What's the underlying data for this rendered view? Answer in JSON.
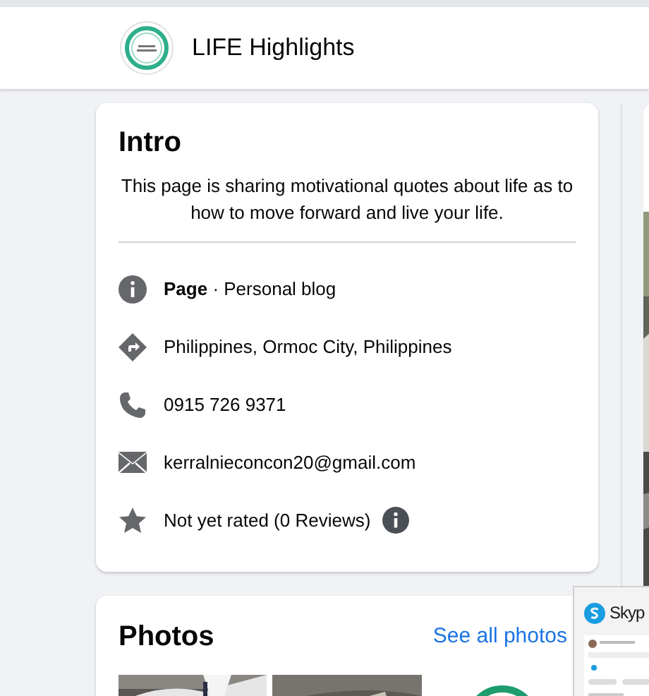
{
  "header": {
    "title": "LIFE Highlights"
  },
  "intro": {
    "title": "Intro",
    "description": "This page is sharing motivational quotes about life as to how to move forward and live your life.",
    "items": [
      {
        "kind": "category",
        "text": "**Page** · Personal blog",
        "info": false
      },
      {
        "kind": "address",
        "text": "Philippines, Ormoc City, Philippines",
        "info": false
      },
      {
        "kind": "phone",
        "text": "0915 726 9371",
        "info": false
      },
      {
        "kind": "email",
        "text": "kerralnieconcon20@gmail.com",
        "info": false
      },
      {
        "kind": "rating",
        "text": "Not yet rated (0 Reviews)",
        "info": true
      }
    ]
  },
  "photos": {
    "title": "Photos",
    "link": "See all photos",
    "items": [
      {
        "kind": "picture"
      },
      {
        "kind": "picture"
      },
      {
        "kind": "logo"
      }
    ]
  },
  "popup": {
    "title": "Skyp"
  }
}
